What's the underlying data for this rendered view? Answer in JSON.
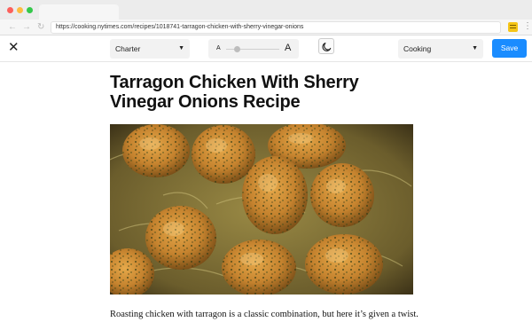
{
  "browser": {
    "url": "https://cooking.nytimes.com/recipes/1018741-tarragon-chicken-with-sherry-vinegar-onions",
    "back_icon": "back-arrow-icon",
    "forward_icon": "forward-arrow-icon",
    "reload_icon": "reload-icon",
    "extension_icon": "notes-extension-icon",
    "menu_icon": "more-menu-icon"
  },
  "toolbar": {
    "close_icon": "close-icon",
    "font_select": "Charter",
    "font_size_small_label": "A",
    "font_size_large_label": "A",
    "font_size_level": 0.2,
    "theme_icon": "moon-icon",
    "collection_select": "Cooking",
    "save_label": "Save",
    "accent_color": "#1a8cff"
  },
  "article": {
    "title": "Tarragon Chicken With Sherry Vinegar Onions Recipe",
    "image_alt": "roasted chicken thighs with herbs and onions",
    "intro": "Roasting chicken with tarragon is a classic combination, but here it’s given a twist."
  }
}
